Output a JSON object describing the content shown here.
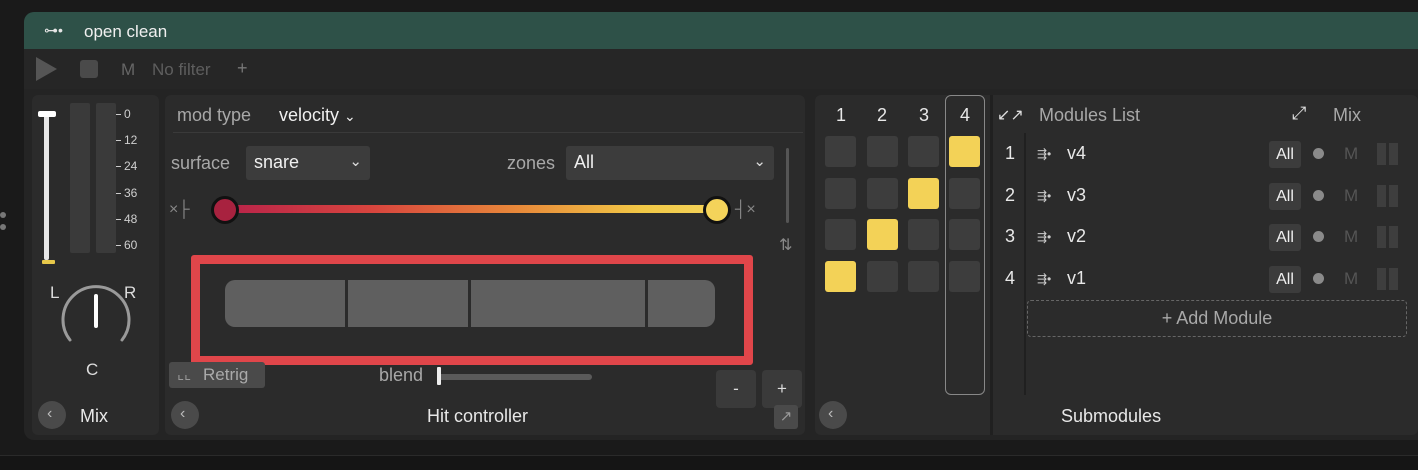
{
  "header": {
    "title": "open clean",
    "icon": "routing-icon"
  },
  "toolbar": {
    "mute_label": "M",
    "filter_label": "No filter",
    "add_label": "+"
  },
  "mix_panel": {
    "scale": [
      "0",
      "12",
      "24",
      "36",
      "48",
      "60"
    ],
    "pan_left": "L",
    "pan_right": "R",
    "pan_center": "C",
    "label": "Mix",
    "fader_level": 1.0
  },
  "hit_controller": {
    "mod_type_label": "mod type",
    "mod_type_value": "velocity",
    "surface_label": "surface",
    "surface_value": "snare",
    "zones_label": "zones",
    "zones_value": "All",
    "retrig_label": "Retrig",
    "blend_label": "blend",
    "blend_value": 0,
    "minus_label": "-",
    "plus_label": "+",
    "label": "Hit controller",
    "gradient_colors": [
      "#b8234a",
      "#f4d35a"
    ]
  },
  "submodules": {
    "columns": [
      "1",
      "2",
      "3",
      "4"
    ],
    "grid": [
      [
        0,
        0,
        0,
        1
      ],
      [
        0,
        0,
        1,
        0
      ],
      [
        0,
        1,
        0,
        0
      ],
      [
        1,
        0,
        0,
        0
      ]
    ],
    "list_title": "Modules List",
    "mix_label": "Mix",
    "rows": [
      {
        "num": "1",
        "name": "v4",
        "zone": "All",
        "mute": "M"
      },
      {
        "num": "2",
        "name": "v3",
        "zone": "All",
        "mute": "M"
      },
      {
        "num": "3",
        "name": "v2",
        "zone": "All",
        "mute": "M"
      },
      {
        "num": "4",
        "name": "v1",
        "zone": "All",
        "mute": "M"
      }
    ],
    "add_module_label": "+ Add Module",
    "label": "Submodules",
    "active_color": "#f3d257"
  }
}
